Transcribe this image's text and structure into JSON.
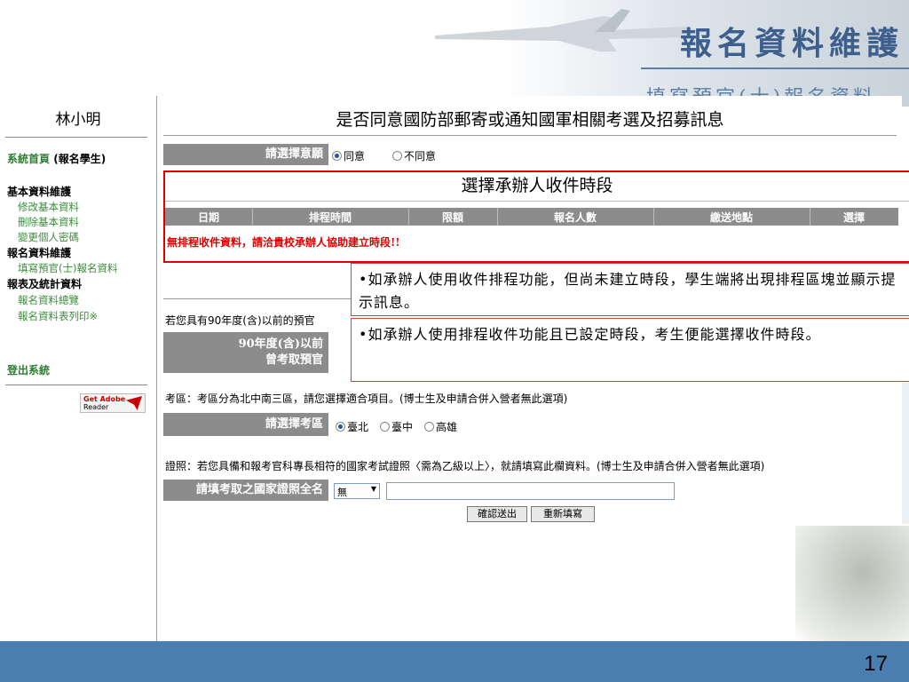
{
  "slide": {
    "title": "報名資料維護",
    "subtitle": "填寫預官(士)報名資料",
    "page_number": "17"
  },
  "sidebar": {
    "user_name": "林小明",
    "home_link": "系統首頁",
    "home_suffix": "(報名學生)",
    "sections": [
      {
        "title": "基本資料維護",
        "items": [
          "修改基本資料",
          "刪除基本資料",
          "變更個人密碼"
        ]
      },
      {
        "title": "報名資料維護",
        "items": [
          "填寫預官(士)報名資料"
        ]
      },
      {
        "title": "報表及統計資料",
        "items": [
          "報名資料總覽",
          "報名資料表列印※"
        ]
      }
    ],
    "logout": "登出系統",
    "reader_badge": {
      "line1": "Get Adobe",
      "line2": "Reader"
    }
  },
  "consent": {
    "question": "是否同意國防部郵寄或通知國軍相關考選及招募訊息",
    "label": "請選擇意願",
    "options": [
      {
        "label": "同意",
        "selected": true
      },
      {
        "label": "不同意",
        "selected": false
      }
    ]
  },
  "schedule": {
    "title": "選擇承辦人收件時段",
    "columns": [
      "日期",
      "排程時間",
      "限額",
      "報名人數",
      "繳送地點",
      "選擇"
    ],
    "empty_message": "無排程收件資料，請洽貴校承辦人協助建立時段!!"
  },
  "notes": [
    "•如承辦人使用收件排程功能，但尚未建立時段，學生端將出現排程區塊並顯示提示訊息。",
    "•如承辦人使用排程收件功能且已設定時段，考生便能選擇收件時段。"
  ],
  "prior_exam": {
    "text": "若您具有90年度(含)以前的預官",
    "label_line1": "90年度(含)以前",
    "label_line2": "曾考取預官"
  },
  "region": {
    "note": "考區：考區分為北中南三區，請您選擇適合項目。(博士生及申請合併入營者無此選項)",
    "label": "請選擇考區",
    "options": [
      {
        "label": "臺北",
        "selected": true
      },
      {
        "label": "臺中",
        "selected": false
      },
      {
        "label": "高雄",
        "selected": false
      }
    ]
  },
  "license": {
    "note": "證照：若您具備和報考官科專長相符的國家考試證照〈需為乙級以上〉，就請填寫此欄資料。(博士生及申請合併入營者無此選項)",
    "label": "請填考取之國家證照全名",
    "select_value": "無",
    "input_value": ""
  },
  "buttons": {
    "submit": "確認送出",
    "reset": "重新填寫"
  }
}
